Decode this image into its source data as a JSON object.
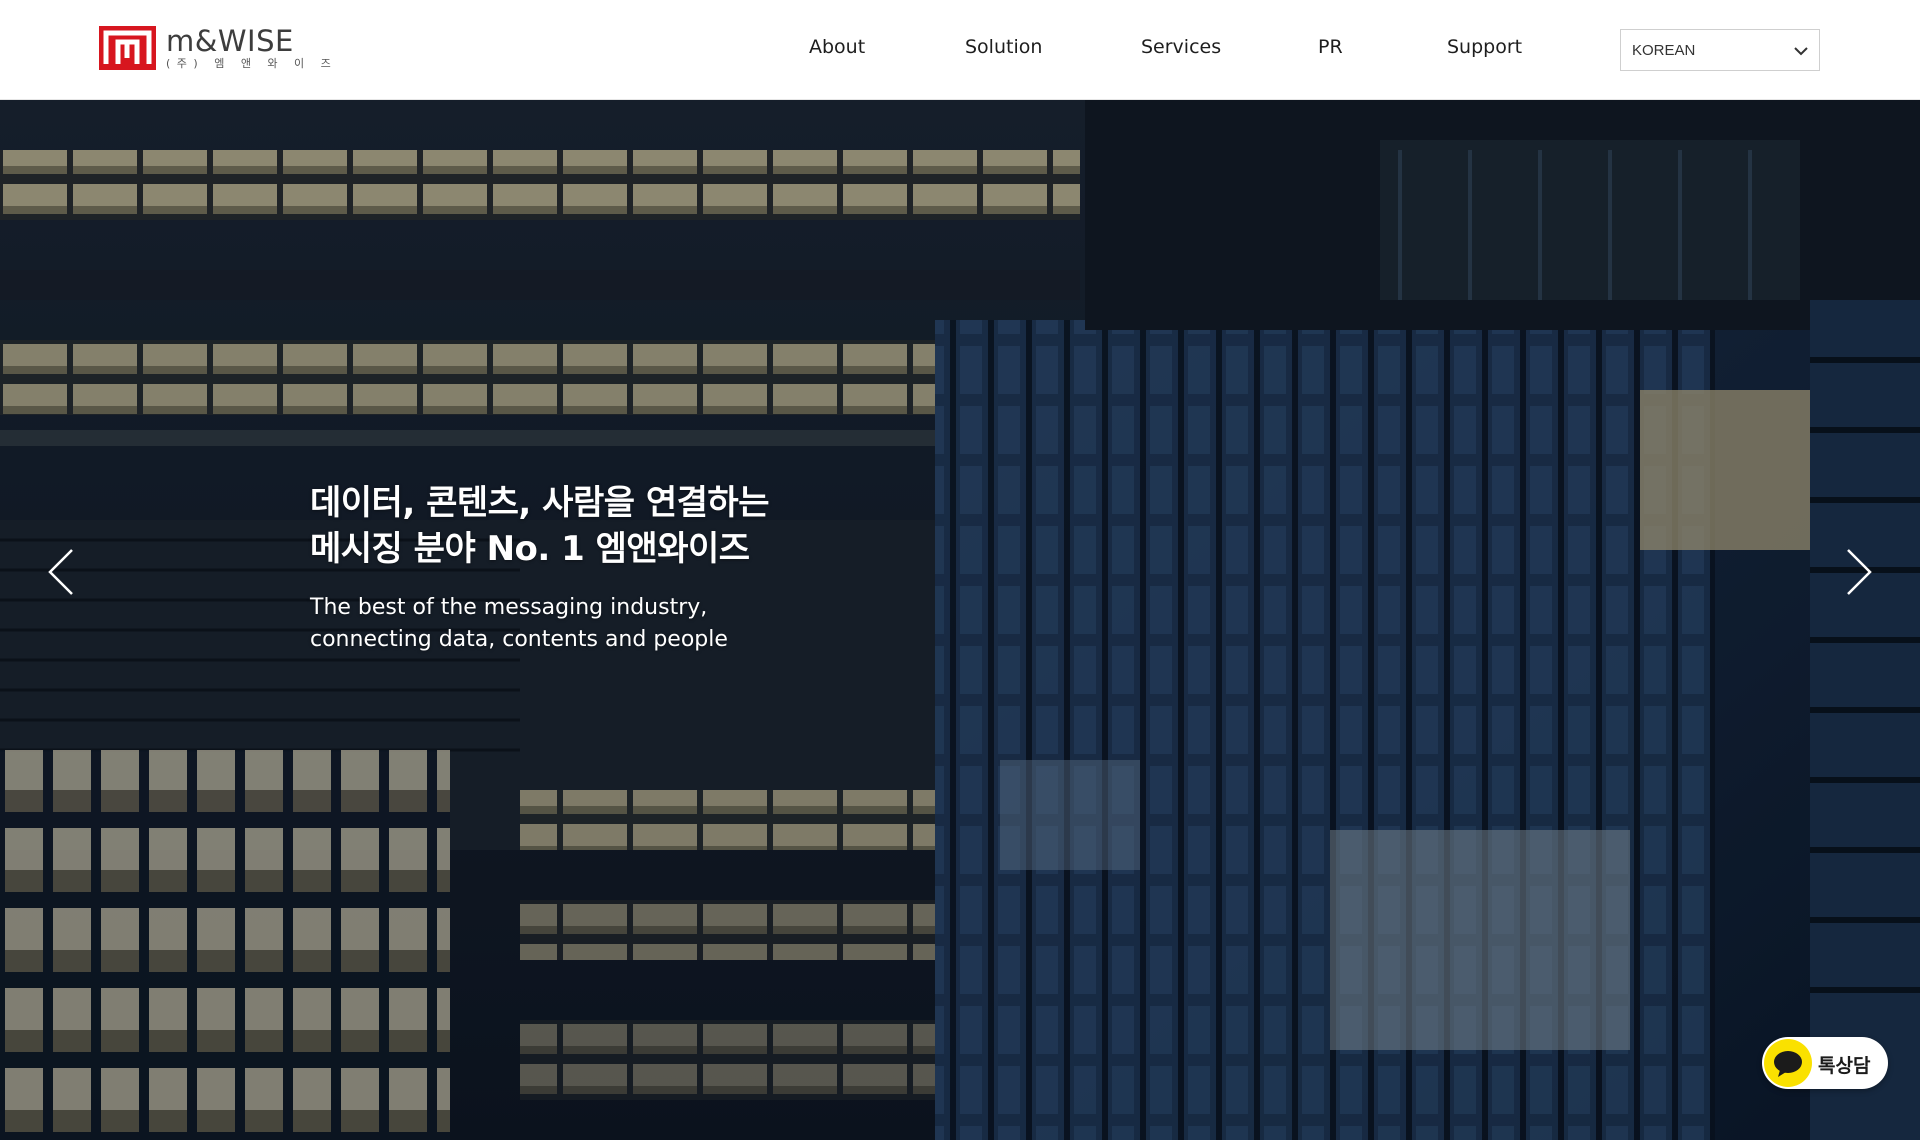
{
  "header": {
    "logo": {
      "name": "m&WISE",
      "subtitle": "(주) 엠 앤 와 이 즈"
    },
    "nav": [
      {
        "label": "About"
      },
      {
        "label": "Solution"
      },
      {
        "label": "Services"
      },
      {
        "label": "PR"
      },
      {
        "label": "Support"
      }
    ],
    "language": {
      "selected": "KOREAN",
      "icon": "chevron-down-icon"
    }
  },
  "hero": {
    "title_line1": "데이터, 콘텐츠, 사람을 연결하는",
    "title_line2": "메시징 분야 No. 1 엠앤와이즈",
    "subtitle_line1": "The best of the messaging industry,",
    "subtitle_line2": "connecting data, contents and people",
    "prev_icon": "chevron-left-icon",
    "next_icon": "chevron-right-icon"
  },
  "chat": {
    "label": "톡상담",
    "icon": "speech-bubble-icon"
  },
  "colors": {
    "brand_red": "#d7161f",
    "kakao_yellow": "#fae100",
    "night_navy": "#0d1a2c"
  }
}
